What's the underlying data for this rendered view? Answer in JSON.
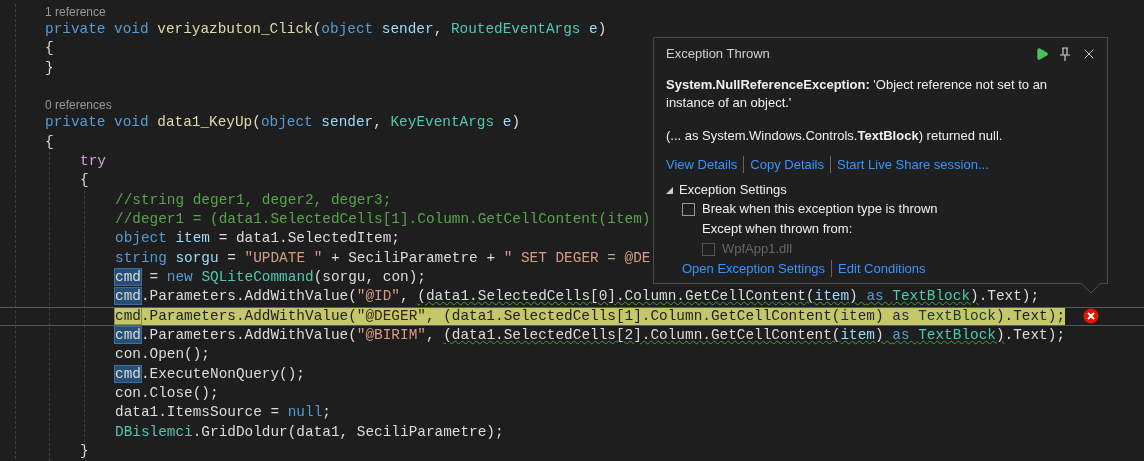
{
  "editor": {
    "lines": [
      {
        "kind": "codelens",
        "text": "1 reference"
      },
      {
        "kind": "code",
        "current": false,
        "error": false,
        "tokens": [
          {
            "text": "private void ",
            "kind": "keyword",
            "squiggle": false
          },
          {
            "text": "veriyazbuton_Click",
            "kind": "method",
            "squiggle": false
          },
          {
            "text": "(",
            "kind": "plain",
            "squiggle": false
          },
          {
            "text": "object ",
            "kind": "keyword",
            "squiggle": false
          },
          {
            "text": "sender",
            "kind": "param",
            "squiggle": false
          },
          {
            "text": ", ",
            "kind": "plain",
            "squiggle": false
          },
          {
            "text": "RoutedEventArgs ",
            "kind": "type",
            "squiggle": false
          },
          {
            "text": "e",
            "kind": "param",
            "squiggle": false
          },
          {
            "text": ")",
            "kind": "plain",
            "squiggle": false
          }
        ]
      },
      {
        "kind": "code",
        "current": false,
        "error": false,
        "tokens": [
          {
            "text": "{",
            "kind": "plain",
            "squiggle": false
          }
        ]
      },
      {
        "kind": "code",
        "current": false,
        "error": false,
        "tokens": [
          {
            "text": "}",
            "kind": "plain",
            "squiggle": false
          }
        ]
      },
      {
        "kind": "blank"
      },
      {
        "kind": "codelens",
        "text": "0 references"
      },
      {
        "kind": "code",
        "current": false,
        "error": false,
        "tokens": [
          {
            "text": "private void ",
            "kind": "keyword",
            "squiggle": false
          },
          {
            "text": "data1_KeyUp",
            "kind": "method",
            "squiggle": false
          },
          {
            "text": "(",
            "kind": "plain",
            "squiggle": false
          },
          {
            "text": "object ",
            "kind": "keyword",
            "squiggle": false
          },
          {
            "text": "sender",
            "kind": "param",
            "squiggle": false
          },
          {
            "text": ", ",
            "kind": "plain",
            "squiggle": false
          },
          {
            "text": "KeyEventArgs ",
            "kind": "type",
            "squiggle": false
          },
          {
            "text": "e",
            "kind": "param",
            "squiggle": false
          },
          {
            "text": ")",
            "kind": "plain",
            "squiggle": false
          }
        ]
      },
      {
        "kind": "code",
        "current": false,
        "error": false,
        "tokens": [
          {
            "text": "{",
            "kind": "plain",
            "squiggle": false
          }
        ],
        "children": [
          {
            "kind": "code",
            "current": false,
            "error": false,
            "tokens": [
              {
                "text": "try",
                "kind": "control",
                "squiggle": false
              }
            ]
          },
          {
            "kind": "code",
            "current": false,
            "error": false,
            "tokens": [
              {
                "text": "{",
                "kind": "plain",
                "squiggle": false
              }
            ],
            "children": [
              {
                "kind": "code",
                "current": false,
                "error": false,
                "tokens": [
                  {
                    "text": "//string deger1, deger2, deger3;",
                    "kind": "comment",
                    "squiggle": false
                  }
                ]
              },
              {
                "kind": "code",
                "current": false,
                "error": false,
                "tokens": [
                  {
                    "text": "//deger1 = (data1.SelectedCells[1].Column.GetCellContent(item)",
                    "kind": "comment",
                    "squiggle": false
                  }
                ]
              },
              {
                "kind": "code",
                "current": false,
                "error": false,
                "tokens": [
                  {
                    "text": "object ",
                    "kind": "keyword",
                    "squiggle": false
                  },
                  {
                    "text": "item",
                    "kind": "param",
                    "squiggle": false
                  },
                  {
                    "text": " = data1.SelectedItem;",
                    "kind": "plain",
                    "squiggle": false
                  }
                ]
              },
              {
                "kind": "code",
                "current": false,
                "error": false,
                "tokens": [
                  {
                    "text": "string ",
                    "kind": "keyword",
                    "squiggle": false
                  },
                  {
                    "text": "sorgu",
                    "kind": "param",
                    "squiggle": false
                  },
                  {
                    "text": " = ",
                    "kind": "plain",
                    "squiggle": false
                  },
                  {
                    "text": "\"UPDATE \"",
                    "kind": "string",
                    "squiggle": false
                  },
                  {
                    "text": " + SeciliParametre + ",
                    "kind": "plain",
                    "squiggle": false
                  },
                  {
                    "text": "\" SET DEGER = @DE",
                    "kind": "string",
                    "squiggle": false
                  }
                ]
              },
              {
                "kind": "code",
                "current": false,
                "error": false,
                "tokens": [
                  {
                    "text": "cmd",
                    "kind": "ref",
                    "squiggle": false
                  },
                  {
                    "text": " = ",
                    "kind": "plain",
                    "squiggle": false
                  },
                  {
                    "text": "new ",
                    "kind": "keyword",
                    "squiggle": false
                  },
                  {
                    "text": "SQLiteCommand",
                    "kind": "type",
                    "squiggle": false
                  },
                  {
                    "text": "(sorgu, con);",
                    "kind": "plain",
                    "squiggle": false
                  }
                ]
              },
              {
                "kind": "code",
                "current": false,
                "error": false,
                "tokens": [
                  {
                    "text": "cmd",
                    "kind": "ref",
                    "squiggle": false
                  },
                  {
                    "text": ".Parameters.AddWithValue(",
                    "kind": "plain",
                    "squiggle": false
                  },
                  {
                    "text": "\"@ID\"",
                    "kind": "string",
                    "squiggle": false
                  },
                  {
                    "text": ", ",
                    "kind": "plain",
                    "squiggle": false
                  },
                  {
                    "text": "(data1.SelectedCells[0].Column.GetCellContent(",
                    "kind": "plain",
                    "squiggle": true
                  },
                  {
                    "text": "item",
                    "kind": "param",
                    "squiggle": true
                  },
                  {
                    "text": ") ",
                    "kind": "plain",
                    "squiggle": true
                  },
                  {
                    "text": "as ",
                    "kind": "keyword",
                    "squiggle": true
                  },
                  {
                    "text": "TextBlock",
                    "kind": "type",
                    "squiggle": true
                  },
                  {
                    "text": ")",
                    "kind": "plain",
                    "squiggle": true
                  },
                  {
                    "text": ".Text);",
                    "kind": "plain",
                    "squiggle": false
                  }
                ]
              },
              {
                "kind": "code",
                "current": true,
                "error": true,
                "tokens": [
                  {
                    "text": "cmd",
                    "kind": "ref",
                    "squiggle": false
                  },
                  {
                    "text": ".Parameters.AddWithValue(",
                    "kind": "plain",
                    "squiggle": false
                  },
                  {
                    "text": "\"@DEGER\"",
                    "kind": "string",
                    "squiggle": false
                  },
                  {
                    "text": ", (data1.SelectedCells[1].Column.GetCellContent(",
                    "kind": "plain",
                    "squiggle": false
                  },
                  {
                    "text": "item",
                    "kind": "param",
                    "squiggle": false
                  },
                  {
                    "text": ") ",
                    "kind": "plain",
                    "squiggle": false
                  },
                  {
                    "text": "as ",
                    "kind": "keyword",
                    "squiggle": false
                  },
                  {
                    "text": "TextBlock",
                    "kind": "type",
                    "squiggle": false
                  },
                  {
                    "text": ").Text);",
                    "kind": "plain",
                    "squiggle": false
                  }
                ]
              },
              {
                "kind": "code",
                "current": false,
                "error": false,
                "tokens": [
                  {
                    "text": "cmd",
                    "kind": "ref",
                    "squiggle": false
                  },
                  {
                    "text": ".Parameters.AddWithValue(",
                    "kind": "plain",
                    "squiggle": false
                  },
                  {
                    "text": "\"@BIRIM\"",
                    "kind": "string",
                    "squiggle": false
                  },
                  {
                    "text": ", ",
                    "kind": "plain",
                    "squiggle": false
                  },
                  {
                    "text": "(data1.SelectedCells[2].Column.GetCellContent(",
                    "kind": "plain",
                    "squiggle": true
                  },
                  {
                    "text": "item",
                    "kind": "param",
                    "squiggle": true
                  },
                  {
                    "text": ") ",
                    "kind": "plain",
                    "squiggle": true
                  },
                  {
                    "text": "as ",
                    "kind": "keyword",
                    "squiggle": true
                  },
                  {
                    "text": "TextBlock",
                    "kind": "type",
                    "squiggle": true
                  },
                  {
                    "text": ")",
                    "kind": "plain",
                    "squiggle": true
                  },
                  {
                    "text": ".Text);",
                    "kind": "plain",
                    "squiggle": false
                  }
                ]
              },
              {
                "kind": "code",
                "current": false,
                "error": false,
                "tokens": [
                  {
                    "text": "con.Open();",
                    "kind": "plain",
                    "squiggle": false
                  }
                ]
              },
              {
                "kind": "code",
                "current": false,
                "error": false,
                "tokens": [
                  {
                    "text": "cmd",
                    "kind": "ref",
                    "squiggle": false
                  },
                  {
                    "text": ".ExecuteNonQuery();",
                    "kind": "plain",
                    "squiggle": false
                  }
                ]
              },
              {
                "kind": "code",
                "current": false,
                "error": false,
                "tokens": [
                  {
                    "text": "con.Close();",
                    "kind": "plain",
                    "squiggle": false
                  }
                ]
              },
              {
                "kind": "code",
                "current": false,
                "error": false,
                "tokens": [
                  {
                    "text": "data1.ItemsSource = ",
                    "kind": "plain",
                    "squiggle": false
                  },
                  {
                    "text": "null",
                    "kind": "keyword",
                    "squiggle": false
                  },
                  {
                    "text": ";",
                    "kind": "plain",
                    "squiggle": false
                  }
                ]
              },
              {
                "kind": "code",
                "current": false,
                "error": false,
                "tokens": [
                  {
                    "text": "DBislemci",
                    "kind": "type",
                    "squiggle": false
                  },
                  {
                    "text": ".GridDoldur(data1, SeciliParametre);",
                    "kind": "plain",
                    "squiggle": false
                  }
                ]
              }
            ]
          },
          {
            "kind": "code",
            "current": false,
            "error": false,
            "tokens": [
              {
                "text": "}",
                "kind": "plain",
                "squiggle": false
              }
            ]
          }
        ]
      }
    ]
  },
  "exception_popup": {
    "title": "Exception Thrown",
    "message": "**System.NullReferenceException:** 'Object reference not set to an instance of an object.'",
    "detail": "(... as System.Windows.Controls.**TextBlock**) returned null.",
    "links": [
      "View Details",
      "Copy Details",
      "Start Live Share session..."
    ],
    "settings": {
      "title": "Exception Settings",
      "expanded": true,
      "options": [
        {
          "label": "Break when this exception type is thrown",
          "checked": false
        }
      ],
      "except_label": "Except when thrown from:",
      "modules": [
        {
          "label": "WpfApp1.dll",
          "checked": false,
          "disabled": true
        }
      ],
      "links": [
        "Open Exception Settings",
        "Edit Conditions"
      ]
    }
  }
}
